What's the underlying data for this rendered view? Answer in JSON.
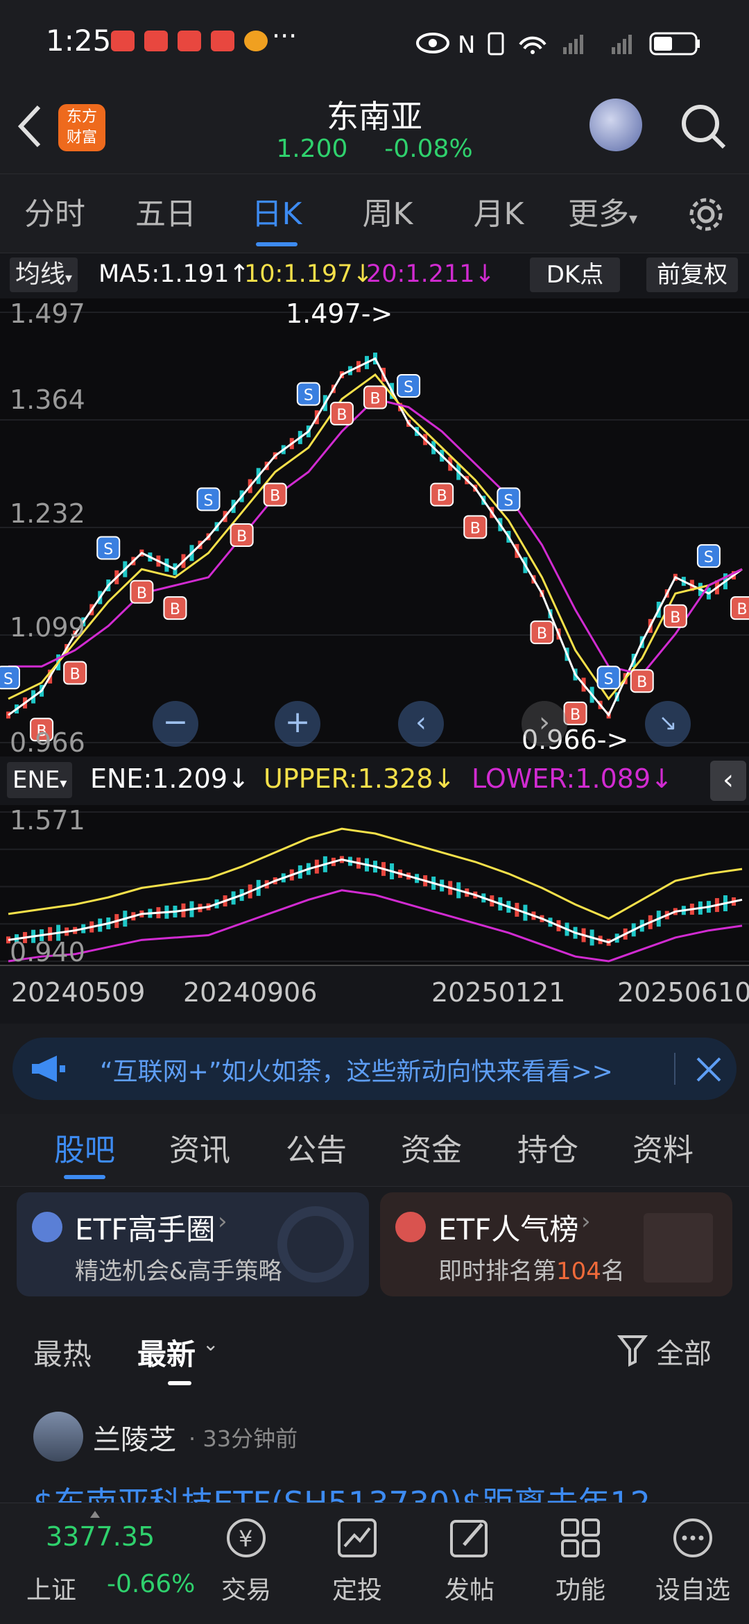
{
  "status": {
    "time": "1:25",
    "dots": "···"
  },
  "header": {
    "title": "东南亚",
    "price": "1.200",
    "change": "-0.08%",
    "logo_line1": "东方",
    "logo_line2": "财富"
  },
  "ktabs": [
    {
      "label": "分时"
    },
    {
      "label": "五日"
    },
    {
      "label": "日K"
    },
    {
      "label": "周K"
    },
    {
      "label": "月K"
    },
    {
      "label": "更多"
    }
  ],
  "ma": {
    "selector": "均线",
    "ma5": "MA5:1.191↑",
    "ma10": "10:1.197↓",
    "ma20": "20:1.211↓",
    "dk": "DK点",
    "fq": "前复权"
  },
  "main_chart": {
    "y_top": "1.497",
    "y_2": "1.364",
    "y_3": "1.232",
    "y_4": "1.099",
    "y_bottom": "0.966",
    "max_note": "1.497->",
    "min_note": "0.966->"
  },
  "ene": {
    "selector": "ENE",
    "ene": "ENE:1.209↓",
    "upper": "UPPER:1.328↓",
    "lower": "LOWER:1.089↓",
    "y_top": "1.571",
    "y_bottom": "0.940"
  },
  "xaxis": [
    "20240509",
    "20240906",
    "20250121",
    "20250610"
  ],
  "banner": {
    "text": "“互联网+”如火如荼，这些新动向快来看看>>"
  },
  "subtabs": [
    {
      "label": "股吧"
    },
    {
      "label": "资讯"
    },
    {
      "label": "公告"
    },
    {
      "label": "资金"
    },
    {
      "label": "持仓"
    },
    {
      "label": "资料"
    }
  ],
  "cards": [
    {
      "title": "ETF高手圈",
      "sub": "精选机会&高手策略"
    },
    {
      "title": "ETF人气榜",
      "sub_pre": "即时排名第",
      "sub_num": "104",
      "sub_post": "名"
    }
  ],
  "sorts": {
    "hot": "最热",
    "newest": "最新",
    "filter": "全部"
  },
  "post": {
    "user": "兰陵芝",
    "time": "· 33分钟前",
    "text": "$东南亚科技ETF(SH513730)$距离去年12"
  },
  "bottom": {
    "index_value": "3377.35",
    "index_name": "上证",
    "index_change": "-0.66%",
    "items": [
      {
        "label": "交易"
      },
      {
        "label": "定投"
      },
      {
        "label": "发帖"
      },
      {
        "label": "功能"
      },
      {
        "label": "设自选"
      }
    ]
  },
  "colors": {
    "up": "#e8473f",
    "down": "#1fc7c7",
    "ma5": "#ffffff",
    "ma10": "#f5e04a",
    "ma20": "#d12bd1",
    "accent": "#3d8bf2",
    "green": "#2fd16d"
  },
  "chart_data": [
    {
      "type": "line",
      "title": "",
      "series": [
        {
          "name": "MA5",
          "values": [
            1.0,
            1.03,
            1.1,
            1.16,
            1.2,
            1.18,
            1.22,
            1.27,
            1.32,
            1.35,
            1.42,
            1.44,
            1.36,
            1.32,
            1.28,
            1.22,
            1.15,
            1.05,
            1.0,
            1.09,
            1.17,
            1.15,
            1.18
          ]
        },
        {
          "name": "10",
          "values": [
            1.02,
            1.04,
            1.09,
            1.14,
            1.18,
            1.17,
            1.2,
            1.25,
            1.3,
            1.33,
            1.39,
            1.42,
            1.37,
            1.33,
            1.29,
            1.24,
            1.17,
            1.08,
            1.02,
            1.07,
            1.15,
            1.16,
            1.18
          ]
        },
        {
          "name": "20",
          "values": [
            1.06,
            1.06,
            1.08,
            1.11,
            1.15,
            1.16,
            1.17,
            1.22,
            1.27,
            1.3,
            1.35,
            1.39,
            1.38,
            1.35,
            1.31,
            1.27,
            1.21,
            1.13,
            1.06,
            1.05,
            1.1,
            1.16,
            1.18
          ]
        }
      ],
      "ylim": [
        0.966,
        1.497
      ]
    },
    {
      "type": "line",
      "title": "",
      "series": [
        {
          "name": "ENE",
          "values": [
            1.03,
            1.05,
            1.07,
            1.1,
            1.14,
            1.15,
            1.17,
            1.22,
            1.28,
            1.33,
            1.37,
            1.34,
            1.3,
            1.26,
            1.22,
            1.17,
            1.12,
            1.06,
            1.02,
            1.09,
            1.15,
            1.17,
            1.2
          ]
        },
        {
          "name": "UPPER",
          "values": [
            1.14,
            1.16,
            1.18,
            1.21,
            1.25,
            1.27,
            1.29,
            1.34,
            1.4,
            1.46,
            1.5,
            1.48,
            1.44,
            1.4,
            1.36,
            1.31,
            1.25,
            1.18,
            1.12,
            1.2,
            1.28,
            1.31,
            1.33
          ]
        },
        {
          "name": "LOWER",
          "values": [
            0.94,
            0.96,
            0.97,
            1.0,
            1.03,
            1.04,
            1.05,
            1.1,
            1.15,
            1.2,
            1.24,
            1.22,
            1.18,
            1.14,
            1.1,
            1.06,
            1.01,
            0.96,
            0.94,
            0.99,
            1.04,
            1.07,
            1.09
          ]
        }
      ],
      "ylim": [
        0.94,
        1.571
      ]
    }
  ]
}
